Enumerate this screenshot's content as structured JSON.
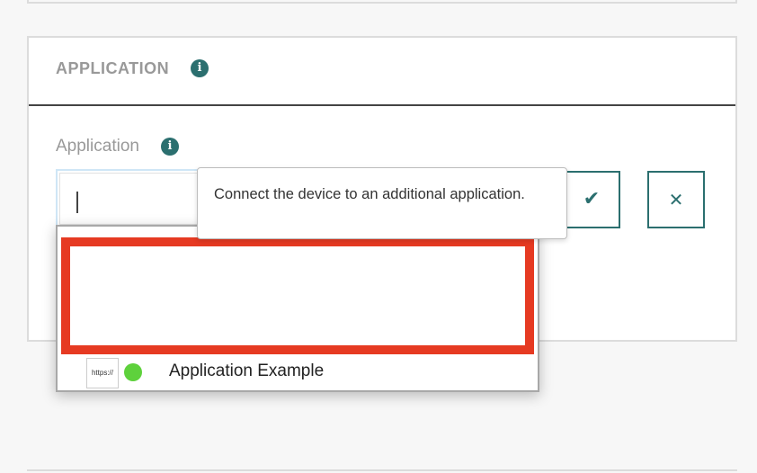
{
  "section": {
    "title": "APPLICATION",
    "title_icon": "info-icon"
  },
  "field": {
    "label": "Application",
    "label_icon": "info-icon",
    "value": ""
  },
  "actions": {
    "confirm_icon": "checkmark-icon",
    "confirm_glyph": "✔",
    "cancel_icon": "close-icon",
    "cancel_glyph": "✕"
  },
  "tooltip": {
    "text": "Connect the device to an additional application."
  },
  "dropdown": {
    "options": [
      {
        "thumb_text": "https://",
        "status_color": "#5ed13c",
        "name": "Application Example"
      }
    ]
  },
  "colors": {
    "accent": "#2b6f6f",
    "highlight_border": "#e63a22",
    "status_online": "#5ed13c"
  }
}
